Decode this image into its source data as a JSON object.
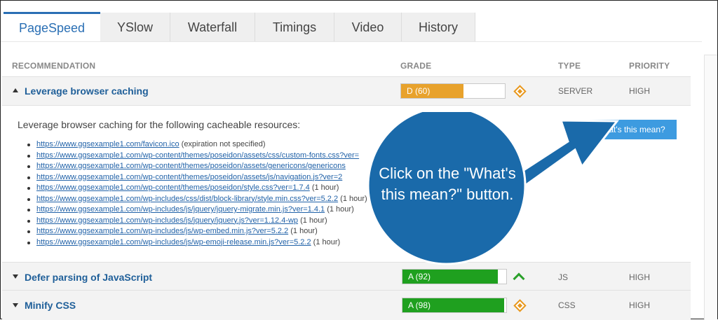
{
  "tabs": [
    {
      "label": "PageSpeed",
      "active": true
    },
    {
      "label": "YSlow",
      "active": false
    },
    {
      "label": "Waterfall",
      "active": false
    },
    {
      "label": "Timings",
      "active": false
    },
    {
      "label": "Video",
      "active": false
    },
    {
      "label": "History",
      "active": false
    }
  ],
  "table_header": {
    "recommendation": "RECOMMENDATION",
    "grade": "GRADE",
    "type": "TYPE",
    "priority": "PRIORITY"
  },
  "rows": [
    {
      "title": "Leverage browser caching",
      "grade_label": "D (60)",
      "grade_percent": 60,
      "grade_color": "#e8a22c",
      "type": "SERVER",
      "priority": "HIGH",
      "icon": "diamond-icon",
      "expanded": true
    },
    {
      "title": "Defer parsing of JavaScript",
      "grade_label": "A (92)",
      "grade_percent": 92,
      "grade_color": "#1fa01f",
      "type": "JS",
      "priority": "HIGH",
      "icon": "chevron-up-icon",
      "expanded": false
    },
    {
      "title": "Minify CSS",
      "grade_label": "A (98)",
      "grade_percent": 98,
      "grade_color": "#1fa01f",
      "type": "CSS",
      "priority": "HIGH",
      "icon": "diamond-icon",
      "expanded": false
    }
  ],
  "details": {
    "description": "Leverage browser caching for the following cacheable resources:",
    "button_label": "What's this mean?",
    "resources": [
      {
        "url": "https://www.ggsexample1.com/favicon.ico",
        "note": " (expiration not specified)"
      },
      {
        "url": "https://www.ggsexample1.com/wp-content/themes/poseidon/assets/css/custom-fonts.css?ver=",
        "note": ""
      },
      {
        "url": "https://www.ggsexample1.com/wp-content/themes/poseidon/assets/genericons/genericons",
        "note": ""
      },
      {
        "url": "https://www.ggsexample1.com/wp-content/themes/poseidon/assets/js/navigation.js?ver=2",
        "note": ""
      },
      {
        "url": "https://www.ggsexample1.com/wp-content/themes/poseidon/style.css?ver=1.7.4",
        "note": " (1 hour)"
      },
      {
        "url": "https://www.ggsexample1.com/wp-includes/css/dist/block-library/style.min.css?ver=5.2.2",
        "note": " (1 hour)"
      },
      {
        "url": "https://www.ggsexample1.com/wp-includes/js/jquery/jquery-migrate.min.js?ver=1.4.1",
        "note": " (1 hour)"
      },
      {
        "url": "https://www.ggsexample1.com/wp-includes/js/jquery/jquery.js?ver=1.12.4-wp",
        "note": " (1 hour)"
      },
      {
        "url": "https://www.ggsexample1.com/wp-includes/js/wp-embed.min.js?ver=5.2.2",
        "note": " (1 hour)"
      },
      {
        "url": "https://www.ggsexample1.com/wp-includes/js/wp-emoji-release.min.js?ver=5.2.2",
        "note": " (1 hour)"
      }
    ]
  },
  "callout": {
    "text": "Click on the \"What's this mean?\" button.",
    "color": "#1a6aaa"
  }
}
